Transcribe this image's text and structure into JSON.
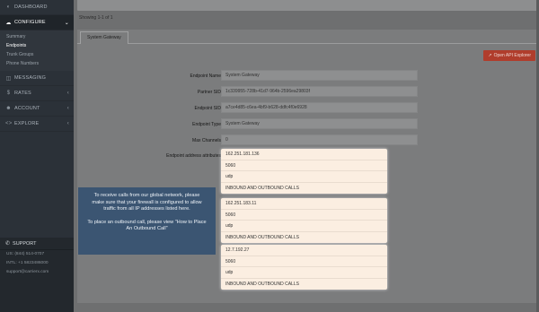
{
  "sidebar": {
    "items": [
      {
        "label": "DASHBOARD",
        "icon": "dashboard-icon"
      },
      {
        "label": "CONFIGURE",
        "icon": "cloud-icon",
        "expanded": true
      },
      {
        "label": "MESSAGING",
        "icon": "chat-icon"
      },
      {
        "label": "RATES",
        "icon": "dollar-icon"
      },
      {
        "label": "ACCOUNT",
        "icon": "user-icon"
      },
      {
        "label": "EXPLORE",
        "icon": "code-icon"
      }
    ],
    "configure_sub": [
      "Summary",
      "Endpoints",
      "Trunk Groups",
      "Phone Numbers"
    ],
    "support": {
      "title": "SUPPORT",
      "lines": [
        "US: (844) 514-0707",
        "INTL: +1 5823486000",
        "support@carrierx.com"
      ]
    }
  },
  "main": {
    "showing": "Showing 1-1 of 1",
    "tab": "System Gateway",
    "api_button": "Open API Explorer",
    "fields": [
      {
        "label": "Endpoint Name",
        "value": "System Gateway"
      },
      {
        "label": "Partner SID",
        "value": "1c339955-728b-41d7-964b-2596ea29803f"
      },
      {
        "label": "Endpoint SID",
        "value": "a7ce4d85-c6ea-4bf9-b628-ddfc4f0e6928"
      },
      {
        "label": "Endpoint Type",
        "value": "System Gateway"
      },
      {
        "label": "Max Channels",
        "value": "0"
      }
    ],
    "attributes_label": "Endpoint address attributes",
    "addresses": [
      {
        "ip": "162.251.181.136",
        "port": "5060",
        "transport": "udp",
        "direction": "INBOUND AND OUTBOUND CALLS"
      },
      {
        "ip": "162.251.183.11",
        "port": "5060",
        "transport": "udp",
        "direction": "INBOUND AND OUTBOUND CALLS"
      },
      {
        "ip": "12.7.192.27",
        "port": "5060",
        "transport": "udp",
        "direction": "INBOUND AND OUTBOUND CALLS"
      }
    ]
  },
  "tooltip": {
    "p1": "To receive calls from our global network, please make sure that your firewall is configured to allow traffic from all IP addresses listed here.",
    "p2": "To place an outbound call, please view \"How to Place An Outbound Call\""
  },
  "colors": {
    "sidebar_bg": "#2b3138",
    "overlay_bg": "#6e6f70",
    "api_button": "#b03d2c",
    "tooltip_bg": "#3b5572",
    "card_bg": "#fbeee1"
  }
}
